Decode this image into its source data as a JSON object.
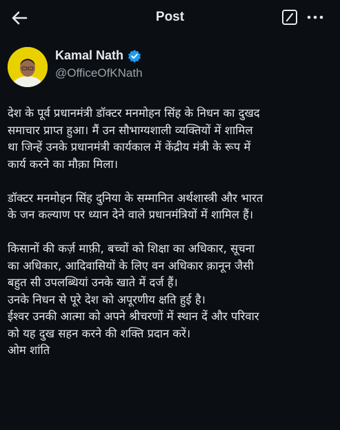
{
  "header": {
    "title": "Post"
  },
  "author": {
    "name": "Kamal Nath",
    "handle": "@OfficeOfKNath"
  },
  "post": {
    "lines": [
      "देश के पूर्व प्रधानमंत्री डॉक्टर मनमोहन सिंह के निधन का दुखद",
      "समाचार प्राप्त हुआ। मैं उन सौभाग्यशाली व्यक्तियों में शामिल",
      "था जिन्हें उनके प्रधानमंत्री कार्यकाल में केंद्रीय मंत्री के रूप में",
      "कार्य करने का मौक़ा मिला।",
      "",
      "डॉक्टर मनमोहन सिंह दुनिया के सम्मानित अर्थशास्त्री और भारत",
      "के जन कल्याण पर ध्यान देने वाले प्रधानमंत्रियों में शामिल हैं।",
      "",
      "किसानों की कर्ज़ माफ़ी, बच्चों को शिक्षा का अधिकार, सूचना",
      "का अधिकार, आदिवासियों के लिए वन अधिकार क़ानून जैसी",
      "बहुत सी उपलब्धियां उनके खाते में दर्ज हैं।",
      "उनके निधन से पूरे देश को अपूरणीय क्षति हुई है।",
      "ईश्वर उनकी आत्मा को अपने श्रीचरणों में स्थान दें और परिवार",
      "को यह दुख सहन करने की शक्ति प्रदान करें।",
      "ओम शांति"
    ]
  },
  "icons": {
    "back": "back-arrow-icon",
    "grok": "grok-icon",
    "more": "more-icon",
    "verified": "verified-badge-icon"
  },
  "colors": {
    "background": "#0b0f14",
    "text": "#e7e9ea",
    "secondary_text": "#9aa3ab",
    "verified_blue": "#1d9bf0",
    "avatar_bg": "#e9d100"
  }
}
